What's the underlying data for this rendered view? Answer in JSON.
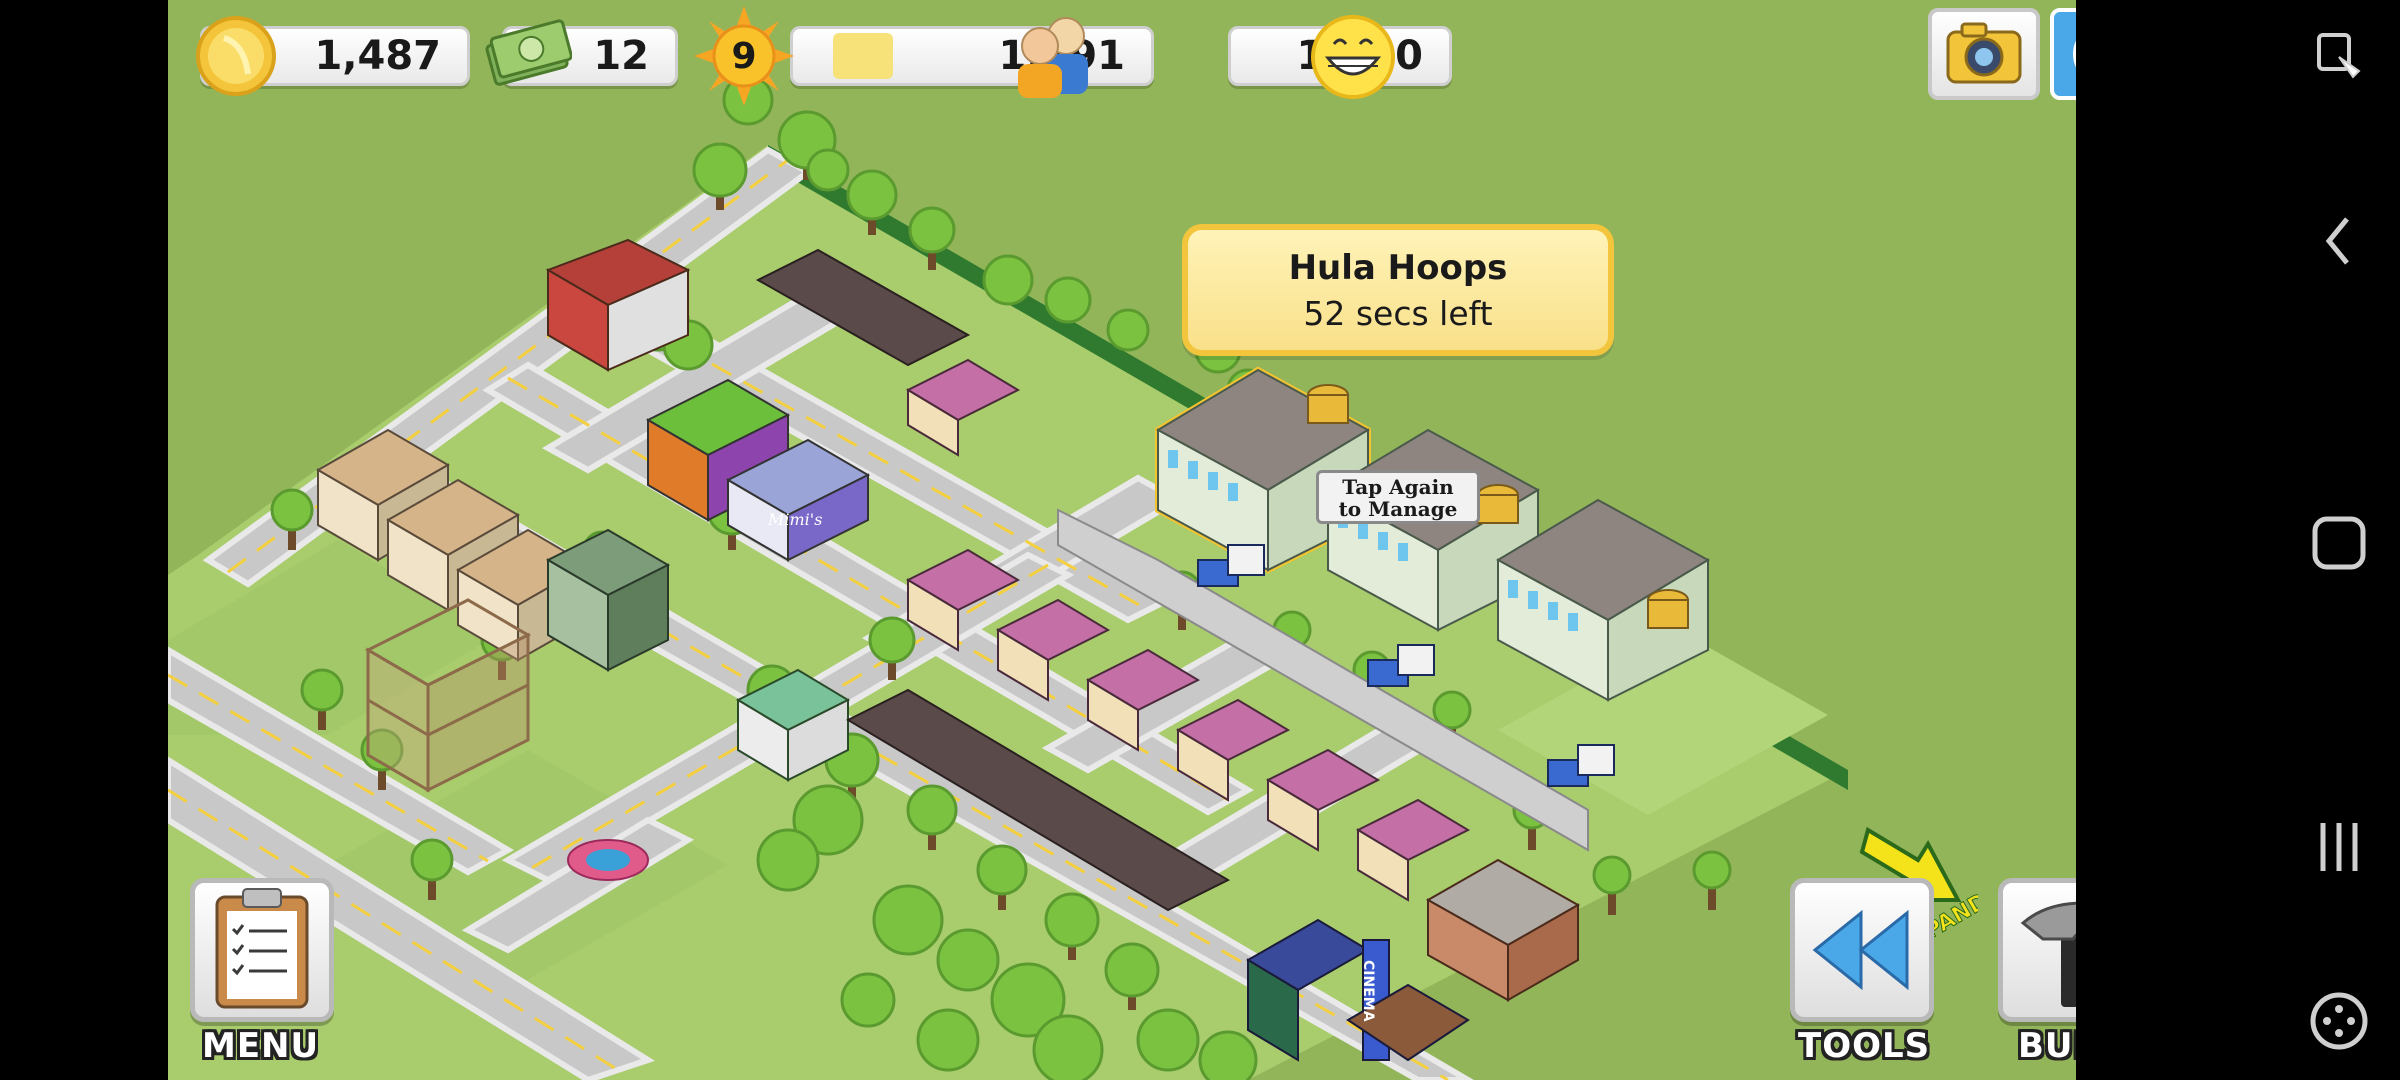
{
  "hud": {
    "coins": "1,487",
    "cash": "12",
    "level": "9",
    "xp": "1,191",
    "population": "1,360"
  },
  "icons": {
    "coins": "gold-coin-icon",
    "cash": "dollar-bills-icon",
    "level": "sun-level-icon",
    "population": "people-icon",
    "happiness": "smiley-face-icon",
    "camera": "camera-icon",
    "social": "social-friends-icon",
    "menu": "clipboard-icon",
    "tools": "rewind-icon",
    "build": "hammer-icon",
    "expand": "arrow-icon"
  },
  "popup": {
    "title": "Hula Hoops",
    "subtitle": "52 secs left"
  },
  "tap_label": {
    "line1": "Tap Again",
    "line2": "to Manage"
  },
  "buttons": {
    "menu": "MENU",
    "tools": "TOOLS",
    "build": "BUILD",
    "expand": "EXPAND"
  },
  "shop_sign": "Mimi's",
  "cinema_sign": "CINEMA",
  "colors": {
    "grass": "#93b55a",
    "road": "#c9c9c9",
    "popup_fill": "#fbe69a",
    "popup_border": "#f2c53d",
    "accent_blue": "#4aa8e8"
  }
}
